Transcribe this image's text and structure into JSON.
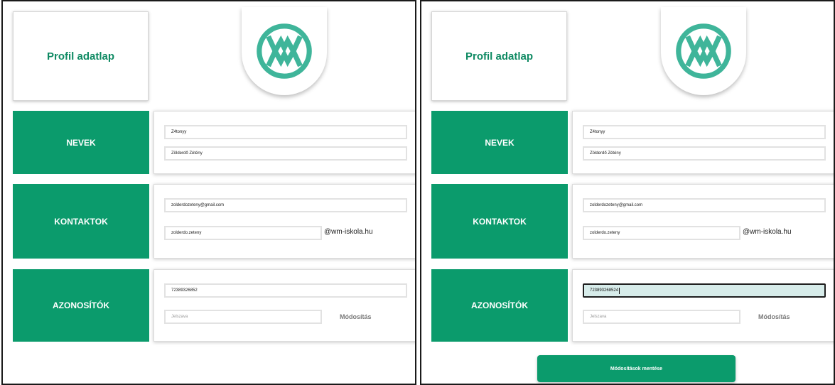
{
  "title": "Profil adatlap",
  "sections": {
    "names": {
      "label": "NEVEK"
    },
    "contacts": {
      "label": "KONTAKTOK"
    },
    "ids": {
      "label": "AZONOSÍTÓK"
    }
  },
  "left": {
    "username": "Z4tonyy",
    "fullname": "Zölderdő Zétény",
    "email": "zolderdozeteny@gmail.com",
    "school_user": "zolderdo.zeteny",
    "school_domain": "@wm-iskola.hu",
    "id_number": "72389326852",
    "password_placeholder": "Jelszava",
    "modify_label": "Módosítás"
  },
  "right": {
    "username": "Z4tonyy",
    "fullname": "Zölderdő Zétény",
    "email": "zolderdozeteny@gmail.com",
    "school_user": "zolderdo.zeteny",
    "school_domain": "@wm-iskola.hu",
    "id_number": "723893268524",
    "password_placeholder": "Jelszava",
    "modify_label": "Módosítás",
    "save_label": "Módosítások mentése"
  },
  "colors": {
    "brand_green": "#0b9b6c",
    "logo_green": "#3fb59a",
    "title_green": "#0f8a63",
    "active_field_bg": "#d7ecea"
  },
  "icons": {
    "logo": "wm-logo-icon"
  }
}
